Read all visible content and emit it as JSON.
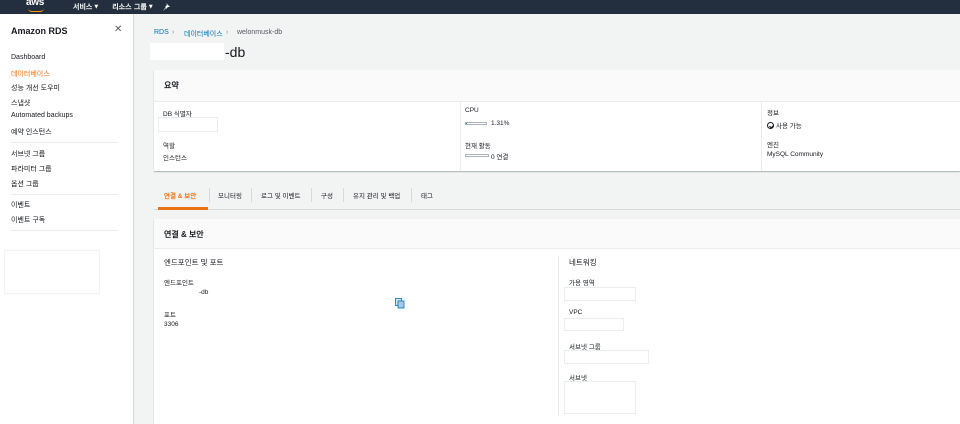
{
  "topbar": {
    "logo": "aws",
    "services": "서비스",
    "resource_groups": "리소스 그룹",
    "caret": "▼",
    "pin_icon": "pin-icon"
  },
  "sidebar": {
    "title": "Amazon RDS",
    "items": [
      {
        "label": "Dashboard",
        "active": false
      },
      {
        "label": "데이터베이스",
        "active": true
      },
      {
        "label": "성능 개선 도우미",
        "active": false
      },
      {
        "label": "스냅샷",
        "active": false
      },
      {
        "label": "Automated backups",
        "active": false
      },
      {
        "label": "예약 인스턴스",
        "active": false
      },
      {
        "label": "서브넷 그룹",
        "active": false
      },
      {
        "label": "파라미터 그룹",
        "active": false
      },
      {
        "label": "옵션 그룹",
        "active": false
      },
      {
        "label": "이벤트",
        "active": false
      },
      {
        "label": "이벤트 구독",
        "active": false
      }
    ]
  },
  "breadcrumb": {
    "rds": "RDS",
    "databases": "데이터베이스",
    "current": "welonmusk-db",
    "sep": "›"
  },
  "page": {
    "title_suffix": "-db"
  },
  "summary": {
    "title": "요약",
    "db_identifier_label": "DB 식별자",
    "role_label": "역할",
    "role_value": "인스턴스",
    "cpu_label": "CPU",
    "cpu_value": "1.31%",
    "cpu_fraction": 0.0131,
    "activity_label": "현재 활동",
    "activity_value": "0 연결",
    "info_label": "정보",
    "info_value": "사용 가능",
    "engine_label": "엔진",
    "engine_value": "MySQL Community"
  },
  "tabs": [
    "연결 & 보안",
    "모니터링",
    "로그 및 이벤트",
    "구성",
    "유지 관리 및 백업",
    "태그"
  ],
  "connectivity": {
    "title": "연결 & 보안",
    "endpoint_section": "엔드포인트 및 포트",
    "endpoint_label": "엔드포인트",
    "endpoint_value": "-db",
    "port_label": "포트",
    "port_value": "3306",
    "network_section": "네트워킹",
    "az_label": "가용 영역",
    "vpc_label": "VPC",
    "subnet_group_label": "서브넷 그룹",
    "subnet_label": "서브넷"
  },
  "colors": {
    "topbar": "#232f3e",
    "accent": "#ec7211",
    "link": "#0073bb"
  }
}
